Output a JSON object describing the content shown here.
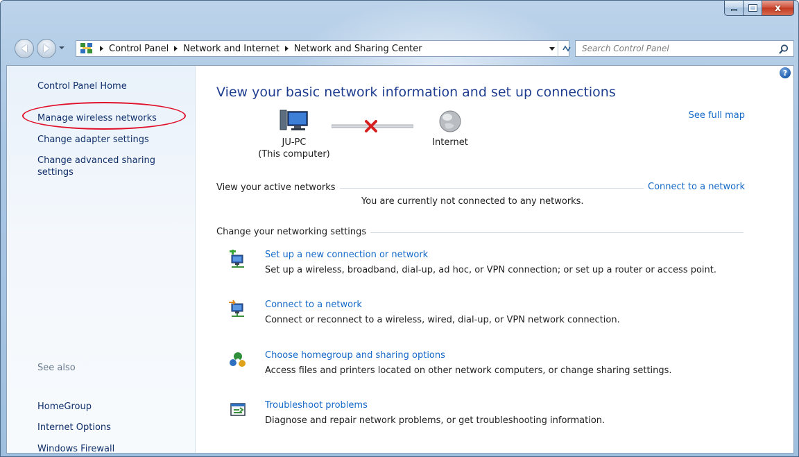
{
  "window": {
    "caption_buttons": {
      "minimize": "minimize",
      "maximize": "maximize",
      "close": "x"
    }
  },
  "navigation": {
    "breadcrumbs": [
      "Control Panel",
      "Network and Internet",
      "Network and Sharing Center"
    ],
    "search_placeholder": "Search Control Panel"
  },
  "sidebar": {
    "home": "Control Panel Home",
    "links": [
      "Manage wireless networks",
      "Change adapter settings",
      "Change advanced sharing settings"
    ],
    "see_also_label": "See also",
    "see_also": [
      "HomeGroup",
      "Internet Options",
      "Windows Firewall"
    ]
  },
  "main": {
    "help_glyph": "?",
    "title": "View your basic network information and set up connections",
    "see_full_map": "See full map",
    "computer_name": "JU-PC",
    "computer_caption": "(This computer)",
    "internet_label": "Internet",
    "active_networks_label": "View your active networks",
    "connect_link": "Connect to a network",
    "not_connected": "You are currently not connected to any networks.",
    "change_settings_label": "Change your networking settings",
    "tasks": [
      {
        "title": "Set up a new connection or network",
        "description": "Set up a wireless, broadband, dial-up, ad hoc, or VPN connection; or set up a router or access point."
      },
      {
        "title": "Connect to a network",
        "description": "Connect or reconnect to a wireless, wired, dial-up, or VPN network connection."
      },
      {
        "title": "Choose homegroup and sharing options",
        "description": "Access files and printers located on other network computers, or change sharing settings."
      },
      {
        "title": "Troubleshoot problems",
        "description": "Diagnose and repair network problems, or get troubleshooting information."
      }
    ]
  },
  "colors": {
    "link": "#1569c7",
    "title": "#1e3d8f",
    "annotation": "#e1102b",
    "frame": "#a9c6e4"
  }
}
